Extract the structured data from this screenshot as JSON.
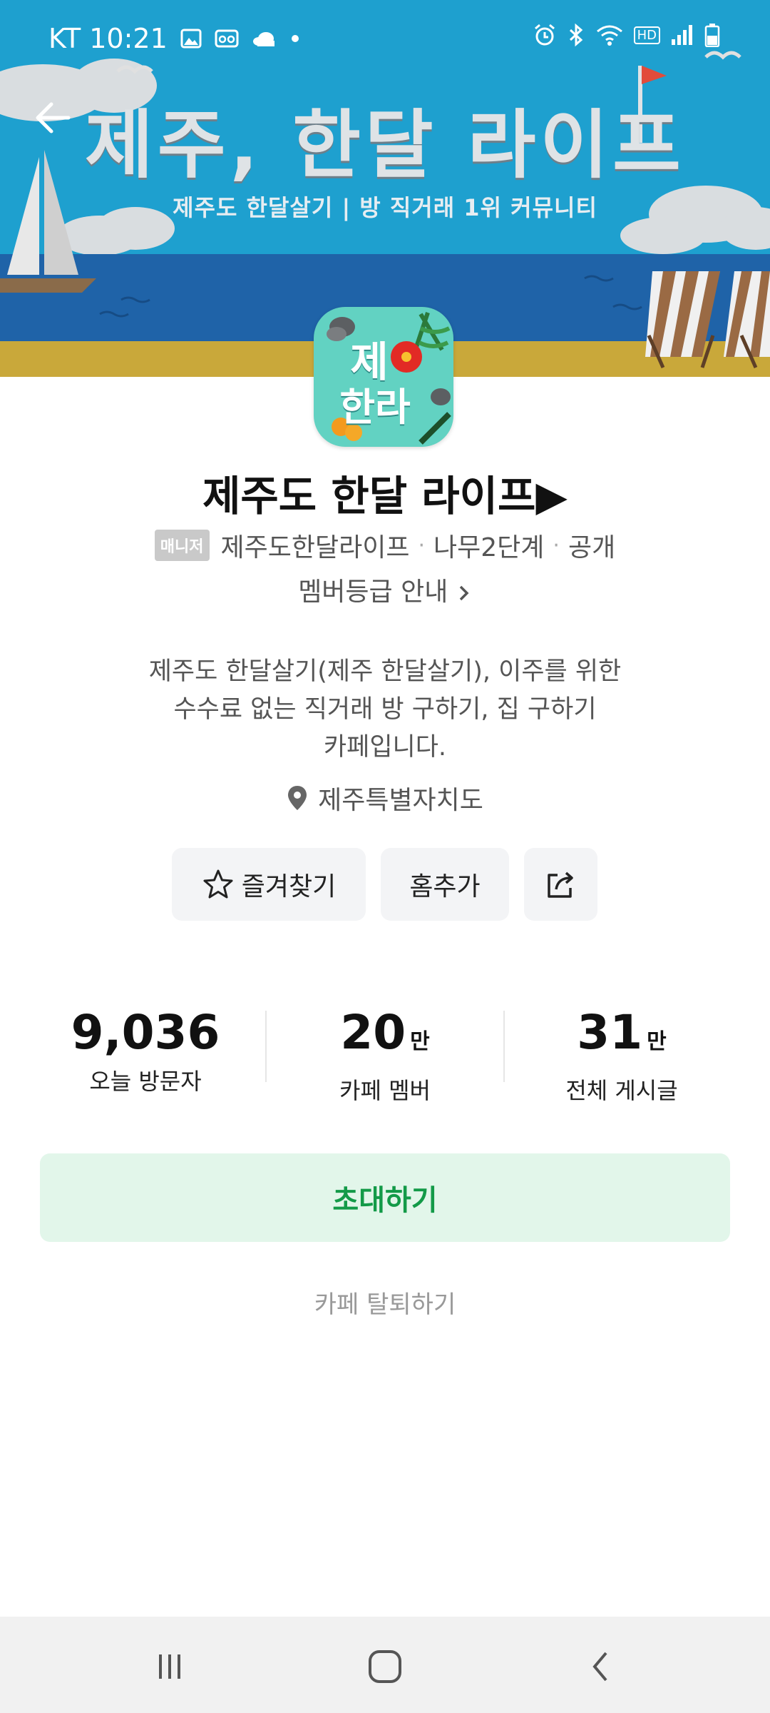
{
  "status_bar": {
    "carrier_time": "KT 10:21",
    "left_icons": [
      "gallery-icon",
      "voicemail-icon",
      "cloud-icon",
      "dot-icon"
    ],
    "right_icons": [
      "alarm-icon",
      "bluetooth-icon",
      "wifi-icon",
      "hd-icon",
      "signal-icon",
      "battery-icon"
    ],
    "hd": "HD"
  },
  "banner": {
    "title": "제주, 한달 라이프",
    "subtitle": "제주도 한달살기  |  방 직거래 1위 커뮤니티",
    "sky_color": "#1ea0cf",
    "sea_color": "#1f63a8",
    "sand_color": "#c9a83a"
  },
  "logo": {
    "line1": "제",
    "line2": "한라",
    "color": "#62d2c2"
  },
  "cafe": {
    "title": "제주도 한달 라이프▶",
    "manager_badge": "매니저",
    "manager_name": "제주도한달라이프",
    "level": "나무2단계",
    "visibility": "공개",
    "member_guide": "멤버등급 안내",
    "description_lines": [
      "제주도 한달살기(제주 한달살기), 이주를 위한",
      "수수료 없는 직거래 방 구하기, 집 구하기",
      "카페입니다."
    ],
    "location": "제주특별자치도"
  },
  "actions": {
    "favorite": "즐겨찾기",
    "add_home": "홈추가"
  },
  "stats": {
    "visitors": {
      "value": "9,036",
      "unit": "",
      "label": "오늘 방문자"
    },
    "members": {
      "value": "20",
      "unit": "만",
      "label": "카페 멤버"
    },
    "posts": {
      "value": "31",
      "unit": "만",
      "label": "전체 게시글"
    }
  },
  "invite_label": "초대하기",
  "leave_label": "카페 탈퇴하기",
  "colors": {
    "invite_bg": "#e2f6ea",
    "invite_text": "#139a48"
  }
}
